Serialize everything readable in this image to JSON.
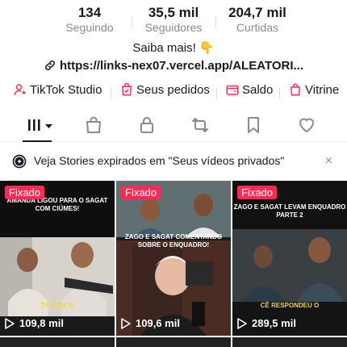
{
  "stats": [
    {
      "value": "134",
      "label": "Seguindo"
    },
    {
      "value": "35,5 mil",
      "label": "Seguidores"
    },
    {
      "value": "204,7 mil",
      "label": "Curtidas"
    }
  ],
  "bio": "Saiba mais! 👇",
  "link": "https://links-nex07.vercel.app/ALEATORI...",
  "shortcuts": [
    {
      "label": "TikTok Studio",
      "icon": "tiktok-studio-icon"
    },
    {
      "label": "Seus pedidos",
      "icon": "orders-icon"
    },
    {
      "label": "Saldo",
      "icon": "wallet-icon"
    },
    {
      "label": "Vitrine",
      "icon": "shopping-bag-icon"
    }
  ],
  "tabs": [
    "videos-grid-icon",
    "shop-bag-icon",
    "lock-icon",
    "repost-icon",
    "bookmark-icon",
    "heart-icon"
  ],
  "banner": {
    "text": "Veja Stories expirados em \"Seus vídeos privados\"",
    "close": "×"
  },
  "videos": [
    {
      "pinned": "Fixado",
      "views": "109,8 mil",
      "caption_top": "AMANDA LIGOU PARA O SAGAT COM CIÚMES!",
      "caption_bottom": "TÁ BOM AI"
    },
    {
      "pinned": "Fixado",
      "views": "109,6 mil",
      "caption_top": "ZAGO E SAGAT COMENTANDO SOBRE O ENQUADRO!",
      "caption_bottom": ""
    },
    {
      "pinned": "Fixado",
      "views": "289,5 mil",
      "caption_top": "ZAGO E SAGAT LEVAM ENQUADRO PARTE 2",
      "caption_bottom": "CÊ RESPONDEU O"
    }
  ],
  "colors": {
    "accent": "#fe2c55",
    "text": "#161823",
    "muted": "#8a8b91"
  }
}
